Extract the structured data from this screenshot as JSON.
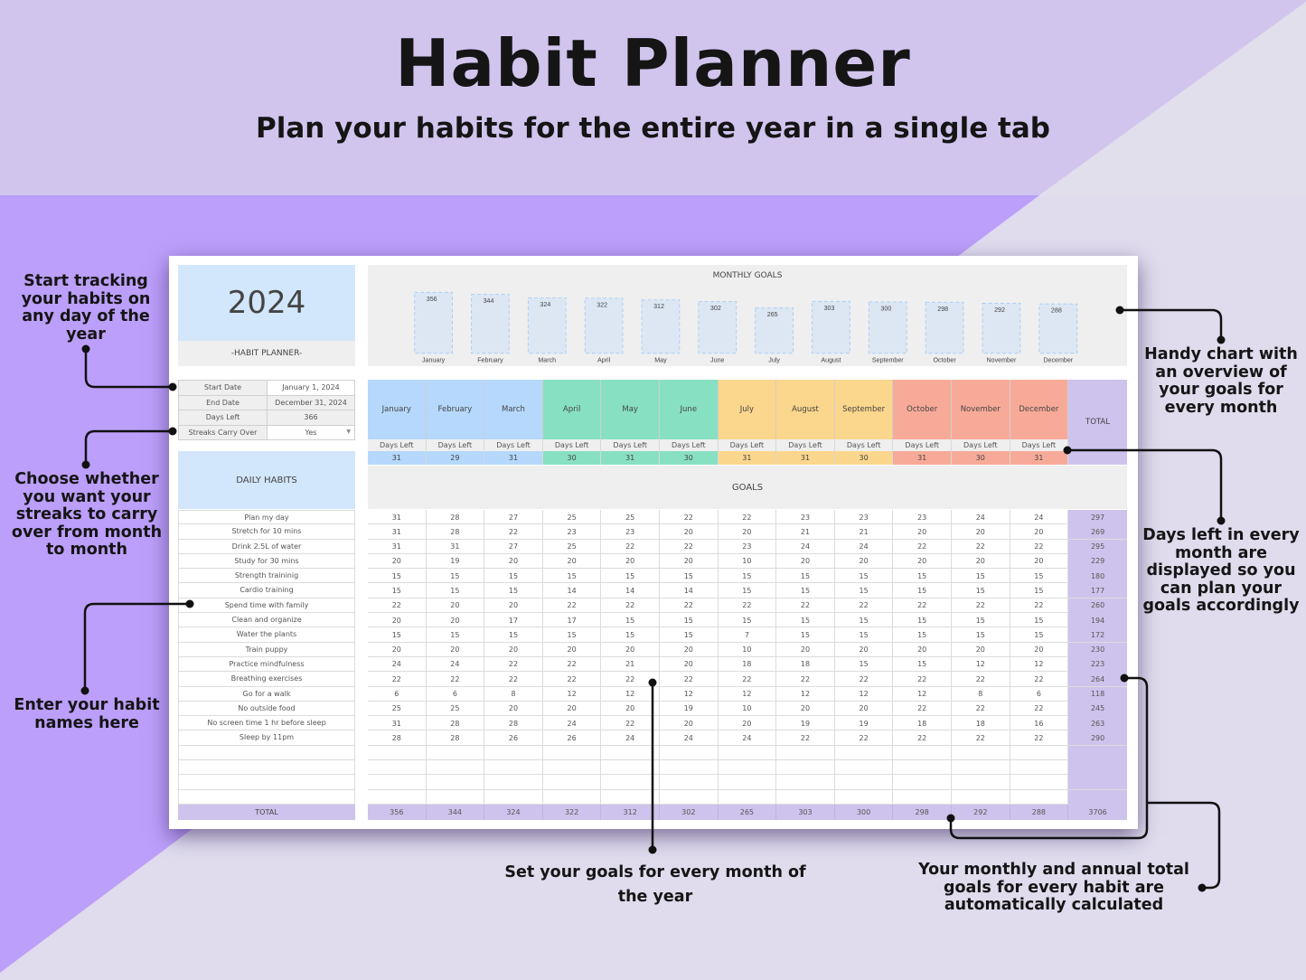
{
  "hero": {
    "title": "Habit Planner",
    "subtitle": "Plan your habits for the entire year in a single tab"
  },
  "colors": {
    "top_band": "#d1c5ee",
    "purple_band": "#bc9ffa",
    "pale_bg": "#e0dcee",
    "q1": "#b5d8fc",
    "q2": "#88e0c3",
    "q3": "#fbd68d",
    "q4": "#f8aa98",
    "total": "#cec3ec",
    "header_blue": "#d2e6fc"
  },
  "sheet": {
    "year": "2024",
    "planner_label": "-HABIT PLANNER-",
    "info": [
      {
        "label": "Start Date",
        "value": "January 1, 2024"
      },
      {
        "label": "End Date",
        "value": "December 31, 2024"
      },
      {
        "label": "Days Left",
        "value": "366"
      },
      {
        "label": "Streaks Carry Over",
        "value": "Yes",
        "dropdown": true
      }
    ],
    "daily_habits_header": "DAILY HABITS",
    "goals_label": "GOALS",
    "total_label": "TOTAL",
    "days_left_label": "Days Left",
    "months": [
      {
        "name": "January",
        "days_left": "31",
        "quarter": "q1"
      },
      {
        "name": "February",
        "days_left": "29",
        "quarter": "q1"
      },
      {
        "name": "March",
        "days_left": "31",
        "quarter": "q1"
      },
      {
        "name": "April",
        "days_left": "30",
        "quarter": "q2"
      },
      {
        "name": "May",
        "days_left": "31",
        "quarter": "q2"
      },
      {
        "name": "June",
        "days_left": "30",
        "quarter": "q2"
      },
      {
        "name": "July",
        "days_left": "31",
        "quarter": "q3"
      },
      {
        "name": "August",
        "days_left": "31",
        "quarter": "q3"
      },
      {
        "name": "September",
        "days_left": "30",
        "quarter": "q3"
      },
      {
        "name": "October",
        "days_left": "31",
        "quarter": "q4"
      },
      {
        "name": "November",
        "days_left": "30",
        "quarter": "q4"
      },
      {
        "name": "December",
        "days_left": "31",
        "quarter": "q4"
      }
    ],
    "habits": [
      {
        "name": "Plan my day",
        "goals": [
          31,
          28,
          27,
          25,
          25,
          22,
          22,
          23,
          23,
          23,
          24,
          24
        ],
        "total": 297
      },
      {
        "name": "Stretch for 10 mins",
        "goals": [
          31,
          28,
          22,
          23,
          23,
          20,
          20,
          21,
          21,
          20,
          20,
          20
        ],
        "total": 269
      },
      {
        "name": "Drink 2.5L of water",
        "goals": [
          31,
          31,
          27,
          25,
          22,
          22,
          23,
          24,
          24,
          22,
          22,
          22
        ],
        "total": 295
      },
      {
        "name": "Study for 30 mins",
        "goals": [
          20,
          19,
          20,
          20,
          20,
          20,
          10,
          20,
          20,
          20,
          20,
          20
        ],
        "total": 229
      },
      {
        "name": "Strength traininig",
        "goals": [
          15,
          15,
          15,
          15,
          15,
          15,
          15,
          15,
          15,
          15,
          15,
          15
        ],
        "total": 180
      },
      {
        "name": "Cardio training",
        "goals": [
          15,
          15,
          15,
          14,
          14,
          14,
          15,
          15,
          15,
          15,
          15,
          15
        ],
        "total": 177
      },
      {
        "name": "Spend time with family",
        "goals": [
          22,
          20,
          20,
          22,
          22,
          22,
          22,
          22,
          22,
          22,
          22,
          22
        ],
        "total": 260
      },
      {
        "name": "Clean and organize",
        "goals": [
          20,
          20,
          17,
          17,
          15,
          15,
          15,
          15,
          15,
          15,
          15,
          15
        ],
        "total": 194
      },
      {
        "name": "Water the plants",
        "goals": [
          15,
          15,
          15,
          15,
          15,
          15,
          7,
          15,
          15,
          15,
          15,
          15
        ],
        "total": 172
      },
      {
        "name": "Train puppy",
        "goals": [
          20,
          20,
          20,
          20,
          20,
          20,
          10,
          20,
          20,
          20,
          20,
          20
        ],
        "total": 230
      },
      {
        "name": "Practice mindfulness",
        "goals": [
          24,
          24,
          22,
          22,
          21,
          20,
          18,
          18,
          15,
          15,
          12,
          12
        ],
        "total": 223
      },
      {
        "name": "Breathing exercises",
        "goals": [
          22,
          22,
          22,
          22,
          22,
          22,
          22,
          22,
          22,
          22,
          22,
          22
        ],
        "total": 264
      },
      {
        "name": "Go for a walk",
        "goals": [
          6,
          6,
          8,
          12,
          12,
          12,
          12,
          12,
          12,
          12,
          8,
          6
        ],
        "total": 118
      },
      {
        "name": "No outside food",
        "goals": [
          25,
          25,
          20,
          20,
          20,
          19,
          10,
          20,
          20,
          22,
          22,
          22
        ],
        "total": 245
      },
      {
        "name": "No screen time 1 hr before sleep",
        "goals": [
          31,
          28,
          28,
          24,
          22,
          20,
          20,
          19,
          19,
          18,
          18,
          16
        ],
        "total": 263
      },
      {
        "name": "Sleep by 11pm",
        "goals": [
          28,
          28,
          26,
          26,
          24,
          24,
          24,
          22,
          22,
          22,
          22,
          22
        ],
        "total": 290
      },
      {
        "name": "",
        "goals": [],
        "total": ""
      },
      {
        "name": "",
        "goals": [],
        "total": ""
      },
      {
        "name": "",
        "goals": [],
        "total": ""
      },
      {
        "name": "",
        "goals": [],
        "total": ""
      }
    ],
    "monthly_totals": [
      356,
      344,
      324,
      322,
      312,
      302,
      265,
      303,
      300,
      298,
      292,
      288
    ],
    "grand_total": 3706
  },
  "chart_data": {
    "type": "bar",
    "title": "MONTHLY GOALS",
    "categories": [
      "January",
      "February",
      "March",
      "April",
      "May",
      "June",
      "July",
      "August",
      "September",
      "October",
      "November",
      "December"
    ],
    "values": [
      356,
      344,
      324,
      322,
      312,
      302,
      265,
      303,
      300,
      298,
      292,
      288
    ],
    "xlabel": "",
    "ylabel": "",
    "grid": false,
    "data_labels": true
  },
  "callouts": {
    "start_tracking": "Start tracking your habits on any day of the year",
    "streaks": "Choose whether you want your streaks to carry over from month to month",
    "habit_names": "Enter your habit names here",
    "chart": "Handy chart with an overview of your goals for every month",
    "days_left": "Days left in every month are displayed so you can plan your goals accordingly",
    "set_goals": "Set your goals for every month of the year",
    "totals": "Your monthly and annual total goals for every habit are automatically calculated"
  }
}
